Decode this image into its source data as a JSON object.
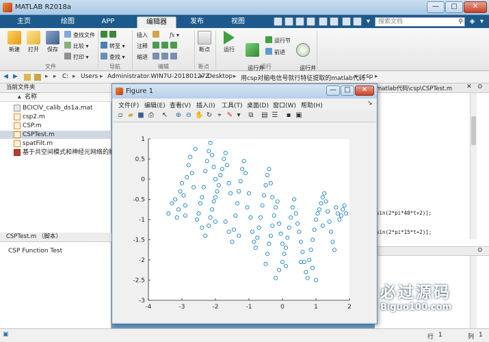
{
  "window": {
    "title": "MATLAB R2018a"
  },
  "window_controls": {
    "minimize": "—",
    "maximize": "□",
    "close": "✕"
  },
  "tabs": [
    {
      "label": "主页"
    },
    {
      "label": "绘图"
    },
    {
      "label": "APP"
    },
    {
      "label": "编辑器",
      "active": true
    },
    {
      "label": "发布"
    },
    {
      "label": "视图"
    }
  ],
  "search": {
    "placeholder": "搜索文档"
  },
  "ribbon": {
    "file_group": {
      "label": "文件",
      "new": "新建",
      "open": "打开",
      "save": "保存",
      "find_files": "查找文件",
      "compare": "比较",
      "print": "打印"
    },
    "nav_group": {
      "label": "导航",
      "goto": "转至",
      "find": "查找"
    },
    "edit_group": {
      "label": "编辑",
      "insert": "插入",
      "comment": "注释",
      "indent": "缩进",
      "fx": "fx"
    },
    "breakpoint_group": {
      "label": "断点",
      "breakpoints": "断点"
    },
    "run_group": {
      "label": "运行",
      "run": "运行",
      "run_advance": "运行并\n前进",
      "run_section": "运行节",
      "advance": "前进",
      "run_time": "运行并\n计时"
    }
  },
  "address": {
    "path": [
      "C:",
      "Users",
      "Administrator.WIN7U-20180127Z",
      "Desktop",
      "用csp对脑电信号就行特征提取的matlab代码",
      "csp"
    ]
  },
  "current_folder": {
    "title": "当前文件夹",
    "column": "名称",
    "files": [
      {
        "name": "BCICIV_calib_ds1a.mat",
        "icon": "mat-file-icon"
      },
      {
        "name": "csp2.m",
        "icon": "m-file-icon"
      },
      {
        "name": "CSP.m",
        "icon": "m-file-icon"
      },
      {
        "name": "CSPTest.m",
        "icon": "m-file-icon",
        "selected": true
      },
      {
        "name": "spatFilt.m",
        "icon": "m-file-icon"
      },
      {
        "name": "基于共空间模式和神经元网络的脑_",
        "icon": "pdf-file-icon"
      }
    ]
  },
  "details": {
    "title": "CSPTest.m （脚本）",
    "text": "CSP Function Test"
  },
  "editor": {
    "path_fragment": "matlab代码\\csp\\CSPTest.m",
    "lines": [
      "sin(2*pi*40*t+2)];",
      "sin(2*pi*15*t+2)];"
    ]
  },
  "status": {
    "line_label": "行",
    "line": "1",
    "col_label": "列",
    "col": "1"
  },
  "watermark": {
    "cn": "必过源码",
    "en": "Biguo100.com"
  },
  "figure": {
    "title": "Figure 1",
    "menu": [
      "文件(F)",
      "编辑(E)",
      "查看(V)",
      "插入(I)",
      "工具(T)",
      "桌面(D)",
      "窗口(W)",
      "帮助(H)"
    ],
    "corner_arrow": "↘"
  },
  "chart_data": {
    "type": "scatter",
    "xlim": [
      -4,
      2
    ],
    "ylim": [
      -3,
      1
    ],
    "xticks": [
      -4,
      -3,
      -2,
      -1,
      0,
      1,
      2
    ],
    "yticks": [
      1,
      0.5,
      0,
      -0.5,
      -1,
      -1.5,
      -2,
      -2.5,
      -3
    ],
    "marker": "circle",
    "color": "#0072bd",
    "grid": false,
    "series": [
      {
        "values": [
          [
            -3.4,
            -0.85
          ],
          [
            -3.3,
            -0.6
          ],
          [
            -3.2,
            -0.5
          ],
          [
            -3.15,
            -0.95
          ],
          [
            -3.1,
            -0.75
          ],
          [
            -3.05,
            -0.3
          ],
          [
            -3.0,
            -0.1
          ],
          [
            -2.95,
            -0.4
          ],
          [
            -2.9,
            -0.65
          ],
          [
            -2.85,
            0.05
          ],
          [
            -2.8,
            0.35
          ],
          [
            -2.75,
            0.55
          ],
          [
            -2.7,
            0.15
          ],
          [
            -2.65,
            -0.2
          ],
          [
            -2.6,
            0.75
          ],
          [
            -2.55,
            -1.0
          ],
          [
            -2.5,
            -0.85
          ],
          [
            -2.45,
            -0.6
          ],
          [
            -2.4,
            -0.45
          ],
          [
            -2.35,
            -0.2
          ],
          [
            -2.3,
            0.2
          ],
          [
            -2.25,
            0.45
          ],
          [
            -2.2,
            0.7
          ],
          [
            -2.15,
            0.9
          ],
          [
            -2.1,
            0.6
          ],
          [
            -2.05,
            0.3
          ],
          [
            -2.0,
            0.0
          ],
          [
            -2.4,
            -1.2
          ],
          [
            -2.3,
            -1.4
          ],
          [
            -2.2,
            -1.15
          ],
          [
            -2.15,
            -0.95
          ],
          [
            -2.1,
            -0.75
          ],
          [
            -2.05,
            -0.55
          ],
          [
            -2.0,
            -0.45
          ],
          [
            -1.95,
            -0.3
          ],
          [
            -1.9,
            -0.15
          ],
          [
            -1.85,
            0.1
          ],
          [
            -1.8,
            0.25
          ],
          [
            -1.75,
            0.5
          ],
          [
            -1.7,
            0.65
          ],
          [
            -1.65,
            0.35
          ],
          [
            -1.6,
            -0.1
          ],
          [
            -1.55,
            -0.35
          ],
          [
            -1.7,
            -1.05
          ],
          [
            -1.6,
            -1.3
          ],
          [
            -1.5,
            -1.55
          ],
          [
            -1.45,
            -1.25
          ],
          [
            -1.4,
            -0.9
          ],
          [
            -1.35,
            -0.6
          ],
          [
            -1.3,
            -0.3
          ],
          [
            -1.25,
            -0.05
          ],
          [
            -1.2,
            0.25
          ],
          [
            -1.15,
            0.45
          ],
          [
            -1.1,
            0.15
          ],
          [
            -1.0,
            -0.35
          ],
          [
            -1.05,
            -0.7
          ],
          [
            -0.95,
            -0.95
          ],
          [
            -0.9,
            -1.3
          ],
          [
            -0.85,
            -1.55
          ],
          [
            -0.8,
            -1.7
          ],
          [
            -0.75,
            -1.45
          ],
          [
            -0.7,
            -1.2
          ],
          [
            -0.65,
            -0.95
          ],
          [
            -0.6,
            -0.65
          ],
          [
            -0.55,
            -0.4
          ],
          [
            -0.5,
            -0.15
          ],
          [
            -0.45,
            0.1
          ],
          [
            -0.4,
            0.25
          ],
          [
            -0.35,
            -0.1
          ],
          [
            -0.3,
            -0.45
          ],
          [
            -0.5,
            -2.1
          ],
          [
            -0.45,
            -1.85
          ],
          [
            -0.4,
            -1.6
          ],
          [
            -0.35,
            -1.4
          ],
          [
            -0.3,
            -1.15
          ],
          [
            -0.25,
            -0.9
          ],
          [
            -0.2,
            -0.7
          ],
          [
            -0.15,
            -0.55
          ],
          [
            -0.1,
            -1.1
          ],
          [
            -0.05,
            -1.35
          ],
          [
            0.0,
            -1.6
          ],
          [
            0.05,
            -1.85
          ],
          [
            0.1,
            -2.15
          ],
          [
            -0.2,
            -2.45
          ],
          [
            -0.1,
            -2.25
          ],
          [
            0.0,
            -2.05
          ],
          [
            0.1,
            -1.7
          ],
          [
            0.15,
            -1.45
          ],
          [
            0.2,
            -1.2
          ],
          [
            0.25,
            -0.95
          ],
          [
            0.3,
            -0.7
          ],
          [
            0.35,
            -0.5
          ],
          [
            0.4,
            -0.85
          ],
          [
            0.45,
            -1.1
          ],
          [
            0.5,
            -1.3
          ],
          [
            0.55,
            -1.55
          ],
          [
            0.6,
            -1.8
          ],
          [
            0.65,
            -2.05
          ],
          [
            0.7,
            -2.3
          ],
          [
            0.75,
            -2.45
          ],
          [
            0.8,
            -2.0
          ],
          [
            0.85,
            -1.75
          ],
          [
            0.9,
            -1.5
          ],
          [
            0.95,
            -1.25
          ],
          [
            1.0,
            -1.0
          ],
          [
            1.05,
            -0.85
          ],
          [
            1.1,
            -0.75
          ],
          [
            1.15,
            -0.6
          ],
          [
            1.2,
            -0.45
          ],
          [
            1.25,
            -0.35
          ],
          [
            1.3,
            -0.55
          ],
          [
            1.35,
            -0.8
          ],
          [
            1.4,
            -1.05
          ],
          [
            1.45,
            -1.3
          ],
          [
            1.5,
            -1.55
          ],
          [
            1.55,
            -1.75
          ],
          [
            1.6,
            -0.7
          ],
          [
            1.65,
            -0.85
          ],
          [
            1.7,
            -1.0
          ],
          [
            1.75,
            -0.9
          ],
          [
            1.8,
            -0.75
          ],
          [
            1.85,
            -0.65
          ],
          [
            1.9,
            -0.85
          ],
          [
            -2.9,
            -0.9
          ],
          [
            -2.0,
            -1.05
          ],
          [
            -1.3,
            -1.4
          ],
          [
            0.9,
            -2.2
          ],
          [
            1.0,
            -2.5
          ],
          [
            0.55,
            -2.05
          ],
          [
            1.2,
            -1.15
          ]
        ]
      }
    ]
  }
}
